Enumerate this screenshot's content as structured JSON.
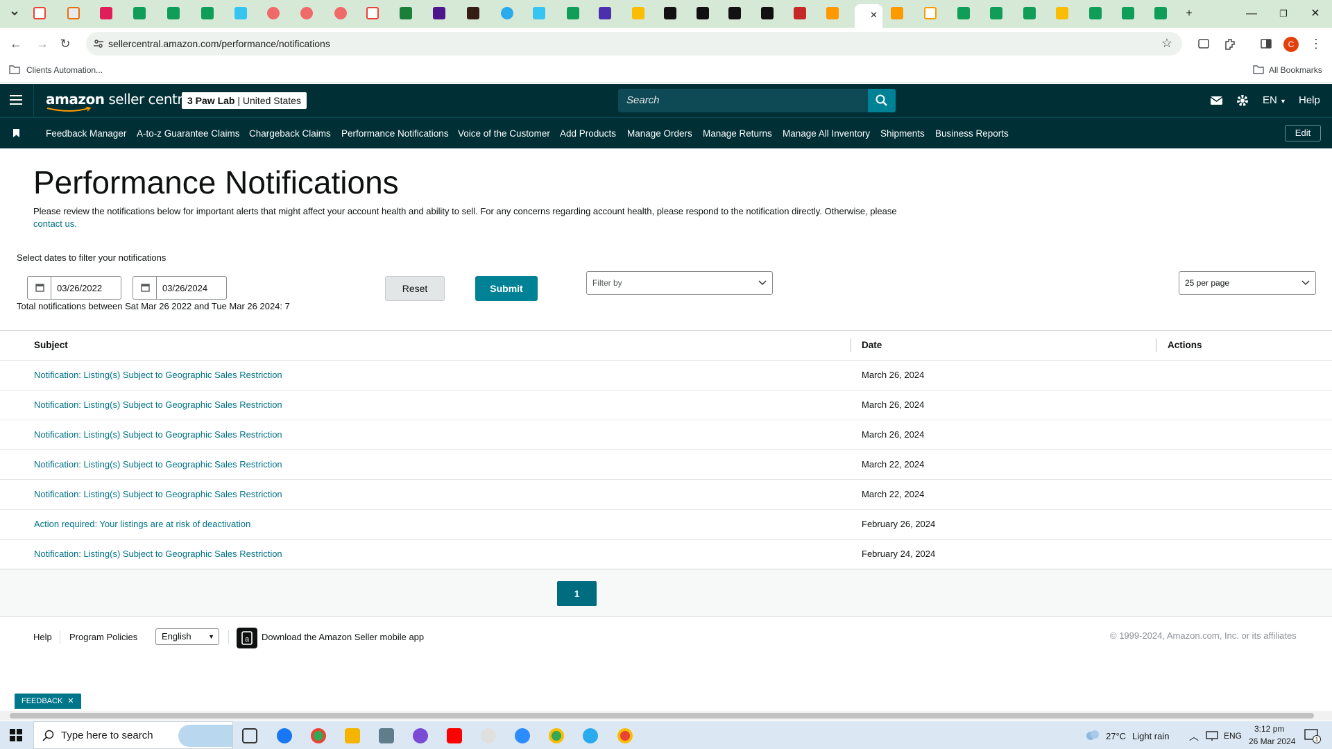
{
  "browser": {
    "url": "sellercentral.amazon.com/performance/notifications",
    "bookmarks": {
      "folder_label": "Clients Automation...",
      "all_label": "All Bookmarks"
    },
    "profile_initial": "C"
  },
  "header": {
    "logo_brand": "amazon",
    "logo_product": "seller central",
    "account_name": "3 Paw Lab",
    "account_region": "United States",
    "search_placeholder": "Search",
    "language": "EN",
    "help_label": "Help"
  },
  "nav": {
    "items": [
      "Feedback Manager",
      "A-to-z Guarantee Claims",
      "Chargeback Claims",
      "Performance Notifications",
      "Voice of the Customer",
      "Add Products",
      "Manage Orders",
      "Manage Returns",
      "Manage All Inventory",
      "Shipments",
      "Business Reports"
    ],
    "edit_label": "Edit"
  },
  "main": {
    "title": "Performance Notifications",
    "intro_text": "Please review the notifications below for important alerts that might affect your account health and ability to sell. For any concerns regarding account health, please respond to the notification directly. Otherwise, please",
    "intro_link": "contact us.",
    "filter_label": "Select dates to filter your notifications",
    "date_from": "03/26/2022",
    "date_to": "03/26/2024",
    "total_text": "Total notifications between Sat Mar 26 2022 and Tue Mar 26 2024: 7",
    "reset_label": "Reset",
    "submit_label": "Submit",
    "filter_by": "Filter by",
    "per_page": "25 per page"
  },
  "table": {
    "columns": [
      "Subject",
      "Date",
      "Actions"
    ],
    "rows": [
      {
        "subject": "Notification: Listing(s) Subject to Geographic Sales Restriction",
        "date": "March 26, 2024"
      },
      {
        "subject": "Notification: Listing(s) Subject to Geographic Sales Restriction",
        "date": "March 26, 2024"
      },
      {
        "subject": "Notification: Listing(s) Subject to Geographic Sales Restriction",
        "date": "March 26, 2024"
      },
      {
        "subject": "Notification: Listing(s) Subject to Geographic Sales Restriction",
        "date": "March 22, 2024"
      },
      {
        "subject": "Notification: Listing(s) Subject to Geographic Sales Restriction",
        "date": "March 22, 2024"
      },
      {
        "subject": "Action required: Your listings are at risk of deactivation",
        "date": "February 26, 2024"
      },
      {
        "subject": "Notification: Listing(s) Subject to Geographic Sales Restriction",
        "date": "February 24, 2024"
      }
    ],
    "current_page": "1"
  },
  "footer": {
    "help": "Help",
    "policies": "Program Policies",
    "language": "English",
    "app_text": "Download the Amazon Seller mobile app",
    "copyright": "© 1999-2024, Amazon.com, Inc. or its affiliates",
    "feedback": "FEEDBACK"
  },
  "taskbar": {
    "search_placeholder": "Type here to search",
    "weather_temp": "27°C",
    "weather_desc": "Light rain",
    "lang": "ENG",
    "time": "3:12 pm",
    "date": "26 Mar 2024",
    "notif_count": "1"
  },
  "colors": {
    "header_bg": "#002f36",
    "link": "#007185",
    "accent": "#008296"
  }
}
